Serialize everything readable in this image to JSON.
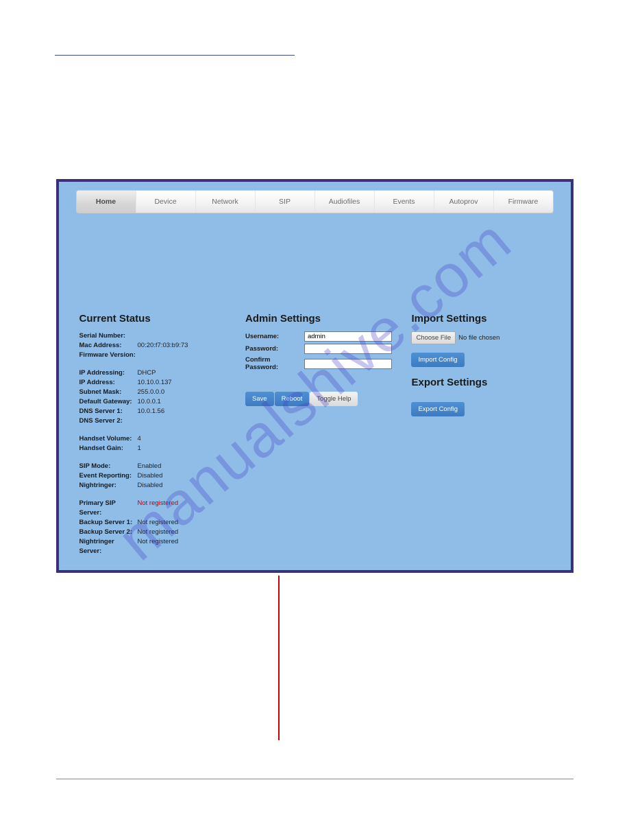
{
  "tabs": [
    "Home",
    "Device",
    "Network",
    "SIP",
    "Audiofiles",
    "Events",
    "Autoprov",
    "Firmware"
  ],
  "active_tab": 0,
  "current_status": {
    "heading": "Current Status",
    "items_a": [
      {
        "l": "Serial Number:",
        "v": ""
      },
      {
        "l": "Mac Address:",
        "v": "00:20:f7:03:b9:73"
      },
      {
        "l": "Firmware Version:",
        "v": ""
      }
    ],
    "items_b": [
      {
        "l": "IP Addressing:",
        "v": "DHCP"
      },
      {
        "l": "IP Address:",
        "v": "10.10.0.137"
      },
      {
        "l": "Subnet Mask:",
        "v": "255.0.0.0"
      },
      {
        "l": "Default Gateway:",
        "v": "10.0.0.1"
      },
      {
        "l": "DNS Server 1:",
        "v": "10.0.1.56"
      },
      {
        "l": "DNS Server 2:",
        "v": ""
      }
    ],
    "items_c": [
      {
        "l": "Handset Volume:",
        "v": "4"
      },
      {
        "l": "Handset Gain:",
        "v": "1"
      }
    ],
    "items_d": [
      {
        "l": "SIP Mode:",
        "v": "Enabled"
      },
      {
        "l": "Event Reporting:",
        "v": "Disabled"
      },
      {
        "l": "Nightringer:",
        "v": "Disabled"
      }
    ],
    "items_e": [
      {
        "l": "Primary SIP Server:",
        "v": "Not registered",
        "red": true
      },
      {
        "l": "Backup Server 1:",
        "v": "Not registered"
      },
      {
        "l": "Backup Server 2:",
        "v": "Not registered"
      },
      {
        "l": "Nightringer Server:",
        "v": "Not registered"
      }
    ]
  },
  "admin": {
    "heading": "Admin Settings",
    "username_label": "Username:",
    "username_value": "admin",
    "password_label": "Password:",
    "confirm_label": "Confirm Password:",
    "save_label": "Save",
    "reboot_label": "Reboot",
    "toggle_label": "Toggle Help"
  },
  "import": {
    "heading": "Import Settings",
    "choose_label": "Choose File",
    "nofile_label": "No file chosen",
    "import_btn": "Import Config"
  },
  "export": {
    "heading": "Export Settings",
    "export_btn": "Export Config"
  },
  "watermark": "manualshive.com"
}
